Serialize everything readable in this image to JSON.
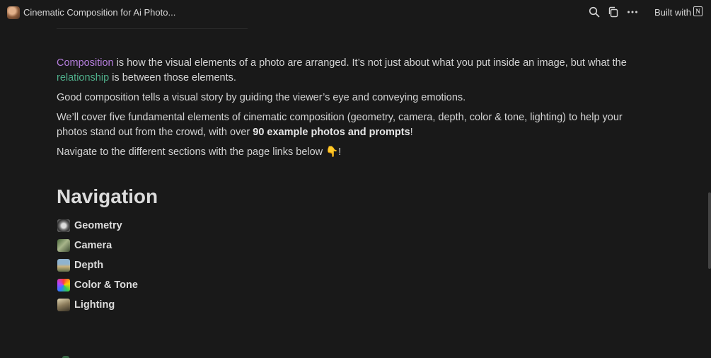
{
  "header": {
    "title": "Cinematic Composition for Ai Photo...",
    "built_with": "Built with",
    "icons": [
      "search-icon",
      "duplicate-icon",
      "more-icon",
      "notion-logo"
    ]
  },
  "intro": {
    "p1_composition": "Composition",
    "p1_rest_a": " is how the visual elements of a photo are arranged. It’s not just about what you put inside an image, but what the ",
    "p1_relationship": "relationship",
    "p1_rest_b": " is between those elements.",
    "p2": "Good composition tells a visual story by guiding the viewer’s eye and conveying emotions.",
    "p3_a": "We’ll cover five fundamental elements of cinematic composition (geometry, camera, depth, color & tone, lighting) to help your photos stand out from the crowd, with over ",
    "p3_bold": "90 example photos and prompts",
    "p3_b": "!",
    "p4": "Navigate to the different sections with the page links below 👇!"
  },
  "navigation": {
    "heading": "Navigation",
    "items": [
      {
        "label": "Geometry",
        "icon": "geometry-thumb"
      },
      {
        "label": "Camera",
        "icon": "camera-thumb"
      },
      {
        "label": "Depth",
        "icon": "depth-thumb"
      },
      {
        "label": "Color & Tone",
        "icon": "color-tone-thumb"
      },
      {
        "label": "Lighting",
        "icon": "lighting-thumb"
      }
    ]
  },
  "colors": {
    "background": "#191919",
    "text": "#d4d4d4",
    "purple_accent": "#b57edc",
    "green_accent": "#4fae8a"
  }
}
